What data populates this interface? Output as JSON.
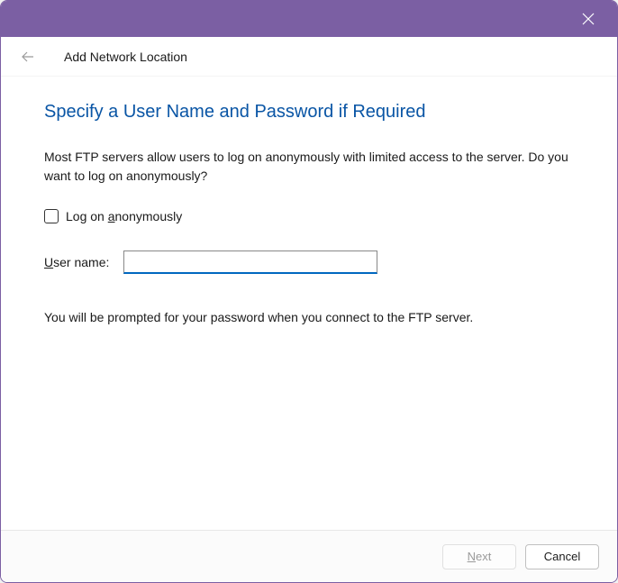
{
  "titlebar": {
    "close_icon": "close"
  },
  "header": {
    "back_icon": "back-arrow",
    "title": "Add Network Location"
  },
  "content": {
    "heading": "Specify a User Name and Password if Required",
    "intro": "Most FTP servers allow users to log on anonymously with limited access to the server.  Do you want to log on anonymously?",
    "checkbox": {
      "checked": false,
      "label_before": "Log on ",
      "label_underline": "a",
      "label_after": "nonymously"
    },
    "username": {
      "label_underline": "U",
      "label_after": "ser name:",
      "value": ""
    },
    "prompt_text": "You will be prompted for your password when you connect to the FTP server."
  },
  "footer": {
    "next": {
      "label_underline": "N",
      "label_after": "ext",
      "enabled": false
    },
    "cancel": {
      "label": "Cancel"
    }
  }
}
